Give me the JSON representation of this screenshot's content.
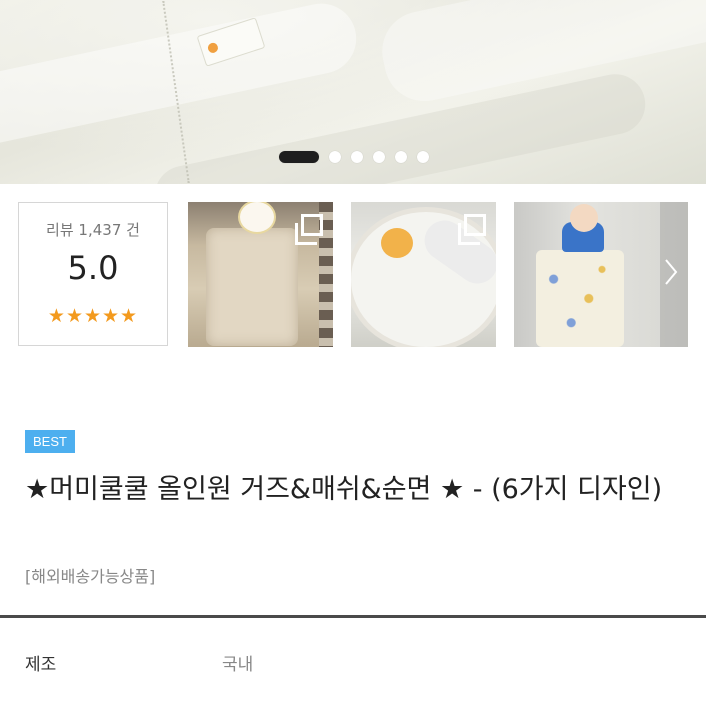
{
  "carousel": {
    "slide_count": 6,
    "active_index": 0
  },
  "review": {
    "count_label": "리뷰 1,437 건",
    "score": "5.0",
    "stars": "★★★★★",
    "star_color": "#f39a1e"
  },
  "thumbnails": [
    {
      "name": "review-photo-1",
      "icon": "multi-image-icon"
    },
    {
      "name": "review-photo-2",
      "icon": "multi-image-icon"
    },
    {
      "name": "review-photo-3",
      "icon": "chevron-right-icon"
    }
  ],
  "product": {
    "badge": "BEST",
    "badge_color": "#4dafef",
    "title": "★머미쿨쿨 올인원 거즈&매쉬&순면 ★ - (6가지 디자인)",
    "subtitle": "[해외배송가능상품]"
  },
  "specs": [
    {
      "label": "제조",
      "value": "국내"
    }
  ]
}
